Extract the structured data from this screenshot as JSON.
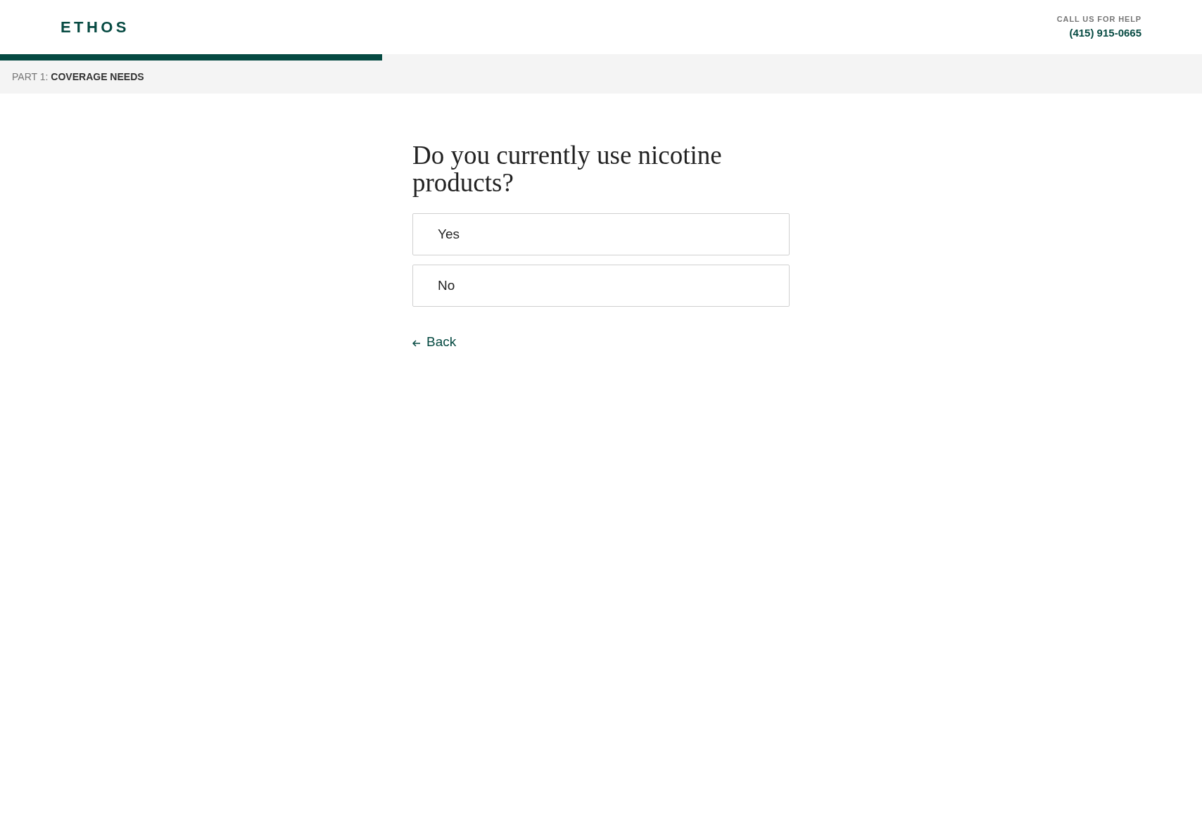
{
  "header": {
    "logo": "ETHOS",
    "help_label": "CALL US FOR HELP",
    "phone": "(415) 915-0665"
  },
  "progress": {
    "level": 0.318
  },
  "section": {
    "part": "PART 1:",
    "name": "COVERAGE NEEDS"
  },
  "question": "Do you currently use nicotine products?",
  "options": [
    {
      "label": "Yes",
      "selected": false
    },
    {
      "label": "No",
      "selected": false
    }
  ],
  "back": "Back"
}
